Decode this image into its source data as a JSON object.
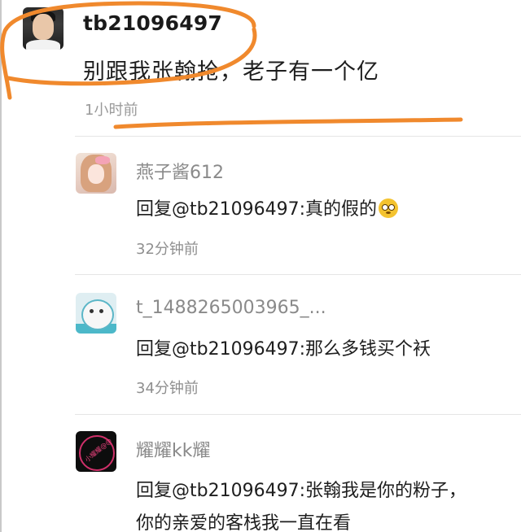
{
  "main_comment": {
    "username": "tb21096497",
    "text": "别跟我张翰抢，老子有一个亿",
    "time": "1小时前",
    "avatar_icon": "user-avatar-man"
  },
  "replies": [
    {
      "username": "燕子酱612",
      "text": "回复@tb21096497:真的假的",
      "emoji": "flushed-face-emoji",
      "time": "32分钟前",
      "avatar_icon": "user-avatar-girl"
    },
    {
      "username": "t_1488265003965_...",
      "text": "回复@tb21096497:那么多钱买个袄",
      "time": "34分钟前",
      "avatar_icon": "user-avatar-seal"
    },
    {
      "username": "耀耀kk耀",
      "text_line1": "回复@tb21096497:张翰我是你的粉子，",
      "text_line2": "你的亲爱的客栈我一直在看",
      "avatar_icon": "user-avatar-dark",
      "avatar_tag": "小耀耀@@"
    }
  ],
  "annotation": {
    "color": "#f0892d"
  }
}
